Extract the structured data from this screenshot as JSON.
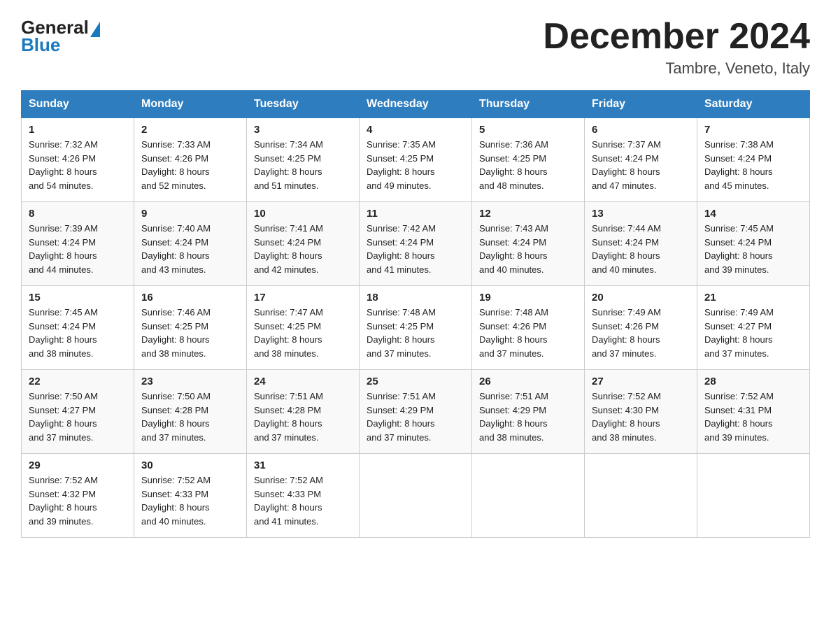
{
  "header": {
    "logo_general": "General",
    "logo_blue": "Blue",
    "month_title": "December 2024",
    "location": "Tambre, Veneto, Italy"
  },
  "days_of_week": [
    "Sunday",
    "Monday",
    "Tuesday",
    "Wednesday",
    "Thursday",
    "Friday",
    "Saturday"
  ],
  "weeks": [
    [
      {
        "day": "1",
        "sunrise": "7:32 AM",
        "sunset": "4:26 PM",
        "daylight": "8 hours and 54 minutes."
      },
      {
        "day": "2",
        "sunrise": "7:33 AM",
        "sunset": "4:26 PM",
        "daylight": "8 hours and 52 minutes."
      },
      {
        "day": "3",
        "sunrise": "7:34 AM",
        "sunset": "4:25 PM",
        "daylight": "8 hours and 51 minutes."
      },
      {
        "day": "4",
        "sunrise": "7:35 AM",
        "sunset": "4:25 PM",
        "daylight": "8 hours and 49 minutes."
      },
      {
        "day": "5",
        "sunrise": "7:36 AM",
        "sunset": "4:25 PM",
        "daylight": "8 hours and 48 minutes."
      },
      {
        "day": "6",
        "sunrise": "7:37 AM",
        "sunset": "4:24 PM",
        "daylight": "8 hours and 47 minutes."
      },
      {
        "day": "7",
        "sunrise": "7:38 AM",
        "sunset": "4:24 PM",
        "daylight": "8 hours and 45 minutes."
      }
    ],
    [
      {
        "day": "8",
        "sunrise": "7:39 AM",
        "sunset": "4:24 PM",
        "daylight": "8 hours and 44 minutes."
      },
      {
        "day": "9",
        "sunrise": "7:40 AM",
        "sunset": "4:24 PM",
        "daylight": "8 hours and 43 minutes."
      },
      {
        "day": "10",
        "sunrise": "7:41 AM",
        "sunset": "4:24 PM",
        "daylight": "8 hours and 42 minutes."
      },
      {
        "day": "11",
        "sunrise": "7:42 AM",
        "sunset": "4:24 PM",
        "daylight": "8 hours and 41 minutes."
      },
      {
        "day": "12",
        "sunrise": "7:43 AM",
        "sunset": "4:24 PM",
        "daylight": "8 hours and 40 minutes."
      },
      {
        "day": "13",
        "sunrise": "7:44 AM",
        "sunset": "4:24 PM",
        "daylight": "8 hours and 40 minutes."
      },
      {
        "day": "14",
        "sunrise": "7:45 AM",
        "sunset": "4:24 PM",
        "daylight": "8 hours and 39 minutes."
      }
    ],
    [
      {
        "day": "15",
        "sunrise": "7:45 AM",
        "sunset": "4:24 PM",
        "daylight": "8 hours and 38 minutes."
      },
      {
        "day": "16",
        "sunrise": "7:46 AM",
        "sunset": "4:25 PM",
        "daylight": "8 hours and 38 minutes."
      },
      {
        "day": "17",
        "sunrise": "7:47 AM",
        "sunset": "4:25 PM",
        "daylight": "8 hours and 38 minutes."
      },
      {
        "day": "18",
        "sunrise": "7:48 AM",
        "sunset": "4:25 PM",
        "daylight": "8 hours and 37 minutes."
      },
      {
        "day": "19",
        "sunrise": "7:48 AM",
        "sunset": "4:26 PM",
        "daylight": "8 hours and 37 minutes."
      },
      {
        "day": "20",
        "sunrise": "7:49 AM",
        "sunset": "4:26 PM",
        "daylight": "8 hours and 37 minutes."
      },
      {
        "day": "21",
        "sunrise": "7:49 AM",
        "sunset": "4:27 PM",
        "daylight": "8 hours and 37 minutes."
      }
    ],
    [
      {
        "day": "22",
        "sunrise": "7:50 AM",
        "sunset": "4:27 PM",
        "daylight": "8 hours and 37 minutes."
      },
      {
        "day": "23",
        "sunrise": "7:50 AM",
        "sunset": "4:28 PM",
        "daylight": "8 hours and 37 minutes."
      },
      {
        "day": "24",
        "sunrise": "7:51 AM",
        "sunset": "4:28 PM",
        "daylight": "8 hours and 37 minutes."
      },
      {
        "day": "25",
        "sunrise": "7:51 AM",
        "sunset": "4:29 PM",
        "daylight": "8 hours and 37 minutes."
      },
      {
        "day": "26",
        "sunrise": "7:51 AM",
        "sunset": "4:29 PM",
        "daylight": "8 hours and 38 minutes."
      },
      {
        "day": "27",
        "sunrise": "7:52 AM",
        "sunset": "4:30 PM",
        "daylight": "8 hours and 38 minutes."
      },
      {
        "day": "28",
        "sunrise": "7:52 AM",
        "sunset": "4:31 PM",
        "daylight": "8 hours and 39 minutes."
      }
    ],
    [
      {
        "day": "29",
        "sunrise": "7:52 AM",
        "sunset": "4:32 PM",
        "daylight": "8 hours and 39 minutes."
      },
      {
        "day": "30",
        "sunrise": "7:52 AM",
        "sunset": "4:33 PM",
        "daylight": "8 hours and 40 minutes."
      },
      {
        "day": "31",
        "sunrise": "7:52 AM",
        "sunset": "4:33 PM",
        "daylight": "8 hours and 41 minutes."
      },
      null,
      null,
      null,
      null
    ]
  ],
  "labels": {
    "sunrise": "Sunrise:",
    "sunset": "Sunset:",
    "daylight": "Daylight:"
  }
}
